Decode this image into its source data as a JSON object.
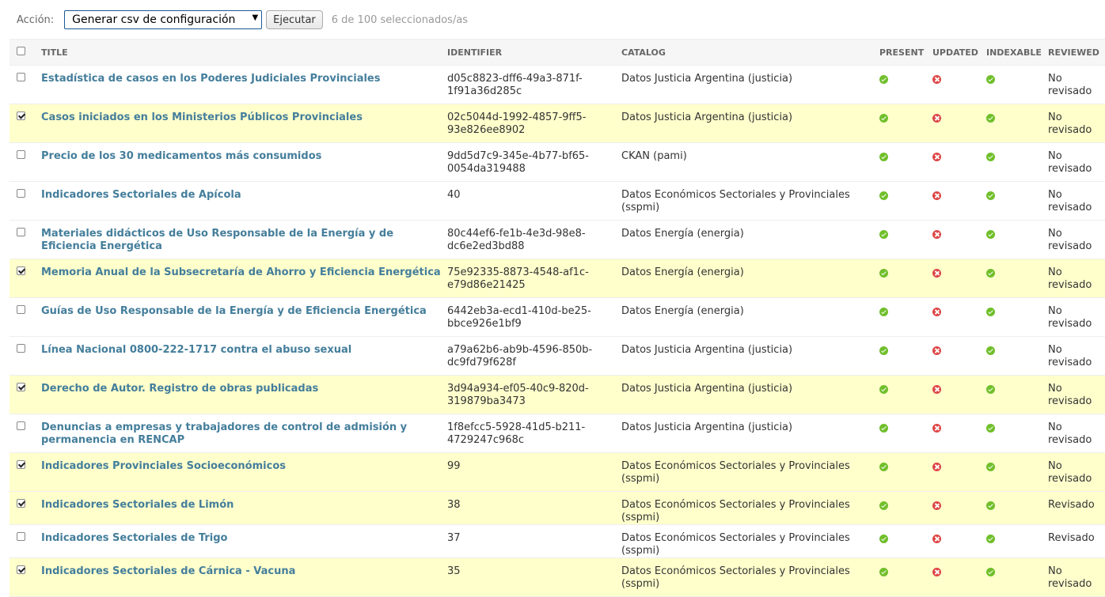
{
  "actions": {
    "label": "Acción:",
    "selected_action": "Generar csv de configuración",
    "execute_label": "Ejecutar",
    "selection_count": "6 de 100 seleccionados/as"
  },
  "columns": [
    "TITLE",
    "IDENTIFIER",
    "CATALOG",
    "PRESENT",
    "UPDATED",
    "INDEXABLE",
    "REVIEWED"
  ],
  "colors": {
    "link": "#447e9b",
    "selected_row": "#ffffcc",
    "ok": "#70bf2b",
    "error": "#dd4646"
  },
  "rows": [
    {
      "checked": false,
      "title": "Estadística de casos en los Poderes Judiciales Provinciales",
      "identifier": "d05c8823-dff6-49a3-871f-1f91a36d285c",
      "catalog": "Datos Justicia Argentina (justicia)",
      "present": true,
      "updated": false,
      "indexable": true,
      "reviewed": "No revisado"
    },
    {
      "checked": true,
      "title": "Casos iniciados en los Ministerios Públicos Provinciales",
      "identifier": "02c5044d-1992-4857-9ff5-93e826ee8902",
      "catalog": "Datos Justicia Argentina (justicia)",
      "present": true,
      "updated": false,
      "indexable": true,
      "reviewed": "No revisado"
    },
    {
      "checked": false,
      "title": "Precio de los 30 medicamentos más consumidos",
      "identifier": "9dd5d7c9-345e-4b77-bf65-0054da319488",
      "catalog": "CKAN (pami)",
      "present": true,
      "updated": false,
      "indexable": true,
      "reviewed": "No revisado"
    },
    {
      "checked": false,
      "title": "Indicadores Sectoriales de Apícola",
      "identifier": "40",
      "catalog": "Datos Económicos Sectoriales y Provinciales (sspmi)",
      "present": true,
      "updated": false,
      "indexable": true,
      "reviewed": "No revisado"
    },
    {
      "checked": false,
      "title": "Materiales didácticos de Uso Responsable de la Energía y de Eficiencia Energética",
      "identifier": "80c44ef6-fe1b-4e3d-98e8-dc6e2ed3bd88",
      "catalog": "Datos Energía (energia)",
      "present": true,
      "updated": false,
      "indexable": true,
      "reviewed": "No revisado"
    },
    {
      "checked": true,
      "title": "Memoria Anual de la Subsecretaría de Ahorro y Eficiencia Energética",
      "identifier": "75e92335-8873-4548-af1c-e79d86e21425",
      "catalog": "Datos Energía (energia)",
      "present": true,
      "updated": false,
      "indexable": true,
      "reviewed": "No revisado"
    },
    {
      "checked": false,
      "title": "Guías de Uso Responsable de la Energía y de Eficiencia Energética",
      "identifier": "6442eb3a-ecd1-410d-be25-bbce926e1bf9",
      "catalog": "Datos Energía (energia)",
      "present": true,
      "updated": false,
      "indexable": true,
      "reviewed": "No revisado"
    },
    {
      "checked": false,
      "title": "Línea Nacional 0800-222-1717 contra el abuso sexual",
      "identifier": "a79a62b6-ab9b-4596-850b-dc9fd79f628f",
      "catalog": "Datos Justicia Argentina (justicia)",
      "present": true,
      "updated": false,
      "indexable": true,
      "reviewed": "No revisado"
    },
    {
      "checked": true,
      "title": "Derecho de Autor. Registro de obras publicadas",
      "identifier": "3d94a934-ef05-40c9-820d-319879ba3473",
      "catalog": "Datos Justicia Argentina (justicia)",
      "present": true,
      "updated": false,
      "indexable": true,
      "reviewed": "No revisado"
    },
    {
      "checked": false,
      "title": "Denuncias a empresas y trabajadores de control de admisión y permanencia en RENCAP",
      "identifier": "1f8efcc5-5928-41d5-b211-4729247c968c",
      "catalog": "Datos Justicia Argentina (justicia)",
      "present": true,
      "updated": false,
      "indexable": true,
      "reviewed": "No revisado"
    },
    {
      "checked": true,
      "title": "Indicadores Provinciales Socioeconómicos",
      "identifier": "99",
      "catalog": "Datos Económicos Sectoriales y Provinciales (sspmi)",
      "present": true,
      "updated": false,
      "indexable": true,
      "reviewed": "No revisado"
    },
    {
      "checked": true,
      "title": "Indicadores Sectoriales de Limón",
      "identifier": "38",
      "catalog": "Datos Económicos Sectoriales y Provinciales (sspmi)",
      "present": true,
      "updated": false,
      "indexable": true,
      "reviewed": "Revisado"
    },
    {
      "checked": false,
      "title": "Indicadores Sectoriales de Trigo",
      "identifier": "37",
      "catalog": "Datos Económicos Sectoriales y Provinciales (sspmi)",
      "present": true,
      "updated": false,
      "indexable": true,
      "reviewed": "Revisado"
    },
    {
      "checked": true,
      "title": "Indicadores Sectoriales de Cárnica - Vacuna",
      "identifier": "35",
      "catalog": "Datos Económicos Sectoriales y Provinciales (sspmi)",
      "present": true,
      "updated": false,
      "indexable": true,
      "reviewed": "No revisado"
    }
  ]
}
